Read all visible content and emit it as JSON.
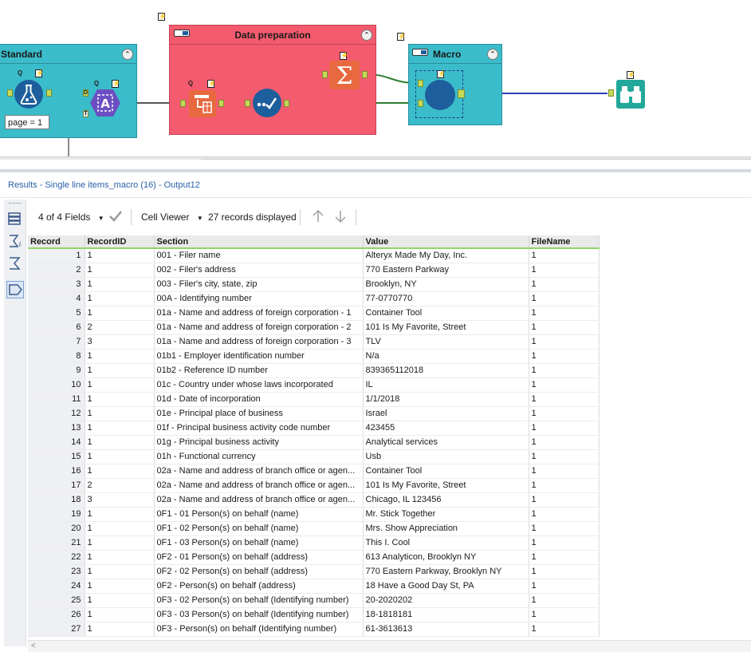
{
  "canvas": {
    "containers": [
      {
        "title": "Standard",
        "collapse": "⌃"
      },
      {
        "title": "Data preparation",
        "collapse": "⌃"
      },
      {
        "title": "Macro",
        "collapse": "⌃"
      }
    ],
    "page_label": "page = 1",
    "anchor_d": "D",
    "anchor_t": "T",
    "scroll_left": "<"
  },
  "results": {
    "title": "Results - Single line items_macro (16) - Output12"
  },
  "toolbar": {
    "fields": "4 of 4 Fields",
    "cell_viewer": "Cell Viewer",
    "records": "27 records displayed"
  },
  "table": {
    "headers": [
      "Record",
      "RecordID",
      "Section",
      "Value",
      "FileName"
    ],
    "rows": [
      [
        "1",
        "1",
        "001 - Filer name",
        "Alteryx Made My Day, Inc.",
        "1"
      ],
      [
        "2",
        "1",
        "002 - Filer's address",
        "770 Eastern Parkway",
        "1"
      ],
      [
        "3",
        "1",
        "003 - Filer's city, state, zip",
        "Brooklyn, NY",
        "1"
      ],
      [
        "4",
        "1",
        "00A - Identifying number",
        "77-0770770",
        "1"
      ],
      [
        "5",
        "1",
        "01a - Name and address of foreign corporation - 1",
        "Container Tool",
        "1"
      ],
      [
        "6",
        "2",
        "01a - Name and address of foreign corporation - 2",
        "101 Is My Favorite, Street",
        "1"
      ],
      [
        "7",
        "3",
        "01a - Name and address of foreign corporation - 3",
        "TLV",
        "1"
      ],
      [
        "8",
        "1",
        "01b1 - Employer identification number",
        "N/a",
        "1"
      ],
      [
        "9",
        "1",
        "01b2 - Reference ID number",
        "839365112018",
        "1"
      ],
      [
        "10",
        "1",
        "01c - Country under whose laws incorporated",
        "IL",
        "1"
      ],
      [
        "11",
        "1",
        "01d - Date of incorporation",
        "1/1/2018",
        "1"
      ],
      [
        "12",
        "1",
        "01e - Principal place of business",
        "Israel",
        "1"
      ],
      [
        "13",
        "1",
        "01f - Principal business activity code number",
        "423455",
        "1"
      ],
      [
        "14",
        "1",
        "01g - Principal business activity",
        "Analytical services",
        "1"
      ],
      [
        "15",
        "1",
        "01h - Functional currency",
        "Usb",
        "1"
      ],
      [
        "16",
        "1",
        "02a - Name and address of branch office or agen...",
        "Container Tool",
        "1"
      ],
      [
        "17",
        "2",
        "02a - Name and address of branch office or agen...",
        "101 Is My Favorite, Street",
        "1"
      ],
      [
        "18",
        "3",
        "02a - Name and address of branch office or agen...",
        "Chicago, IL 123456",
        "1"
      ],
      [
        "19",
        "1",
        "0F1 - 01 Person(s) on behalf (name)",
        "Mr. Stick Together",
        "1"
      ],
      [
        "20",
        "1",
        "0F1 - 02 Person(s) on behalf (name)",
        "Mrs. Show Appreciation",
        "1"
      ],
      [
        "21",
        "1",
        "0F1 - 03 Person(s) on behalf (name)",
        "This I. Cool",
        "1"
      ],
      [
        "22",
        "1",
        "0F2 - 01 Person(s) on behalf (address)",
        "613 Analyticon, Brooklyn NY",
        "1"
      ],
      [
        "23",
        "1",
        "0F2 - 02 Person(s) on behalf (address)",
        "770 Eastern Parkway, Brooklyn NY",
        "1"
      ],
      [
        "24",
        "1",
        "0F2 - Person(s) on behalf (address)",
        "18 Have a Good Day St, PA",
        "1"
      ],
      [
        "25",
        "1",
        "0F3 - 02 Person(s) on behalf (Identifying number)",
        "20-2020202",
        "1"
      ],
      [
        "26",
        "1",
        "0F3 - 03 Person(s) on behalf (Identifying number)",
        "18-1818181",
        "1"
      ],
      [
        "27",
        "1",
        "0F3 - Person(s) on behalf (Identifying number)",
        "61-3613613",
        "1"
      ]
    ]
  },
  "colors": {
    "container_teal": "#3bbcca",
    "container_red": "#f45b6e",
    "tool_blue": "#1d5e9c",
    "tool_orange": "#e8683f",
    "tool_purple": "#6b4fc2",
    "tool_green": "#22a89a",
    "anchor_green": "#c5d957",
    "link_blue": "#2b3fb5"
  }
}
